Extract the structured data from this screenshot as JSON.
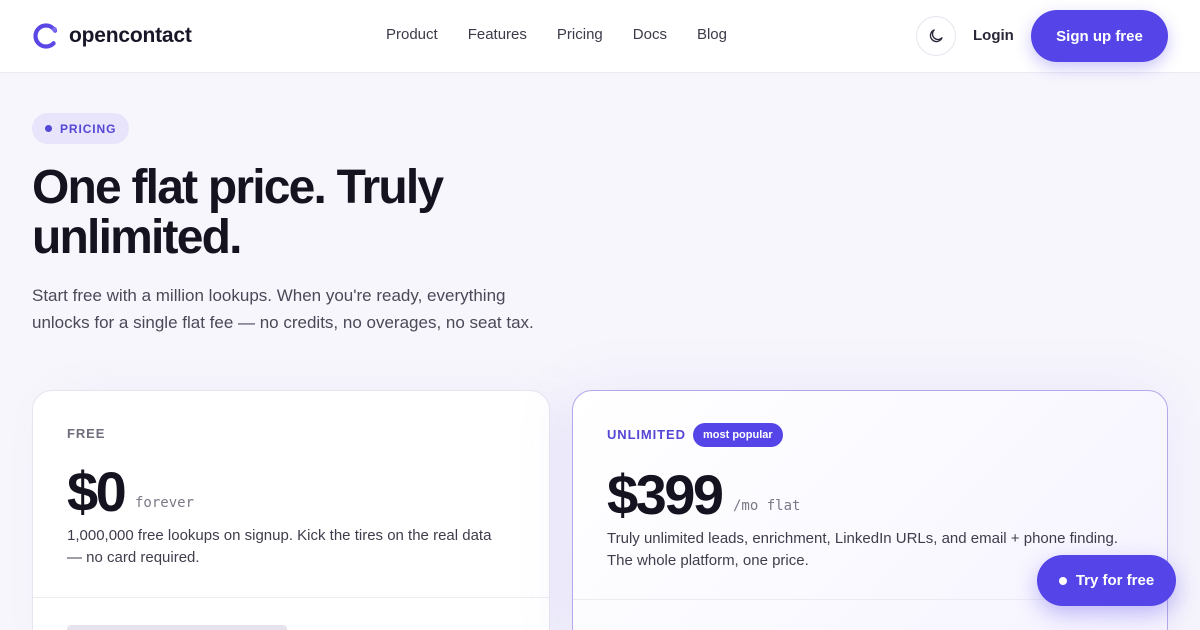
{
  "brand": {
    "name": "opencontact",
    "accent": "#5545e8",
    "logo_icon": "ring-logo-icon"
  },
  "nav": {
    "links": [
      "Product",
      "Features",
      "Pricing",
      "Docs",
      "Blog"
    ],
    "theme_icon": "moon-icon",
    "login": "Login",
    "signup": "Sign up free"
  },
  "hero": {
    "badge": "PRICING",
    "title": "One flat price. Truly unlimited.",
    "subtitle": "Start free with a million lookups. When you're ready, everything unlocks for a single flat fee — no credits, no overages, no seat tax."
  },
  "plans": [
    {
      "name": "FREE",
      "price": "$0",
      "period": "forever",
      "description": "1,000,000 free lookups on signup. Kick the tires on the real data — no card required."
    },
    {
      "name": "UNLIMITED",
      "tag": "most popular",
      "price": "$399",
      "period": "/mo flat",
      "description": "Truly unlimited leads, enrichment, LinkedIn URLs, and email + phone finding. The whole platform, one price."
    }
  ],
  "floating_cta": "Try for free"
}
